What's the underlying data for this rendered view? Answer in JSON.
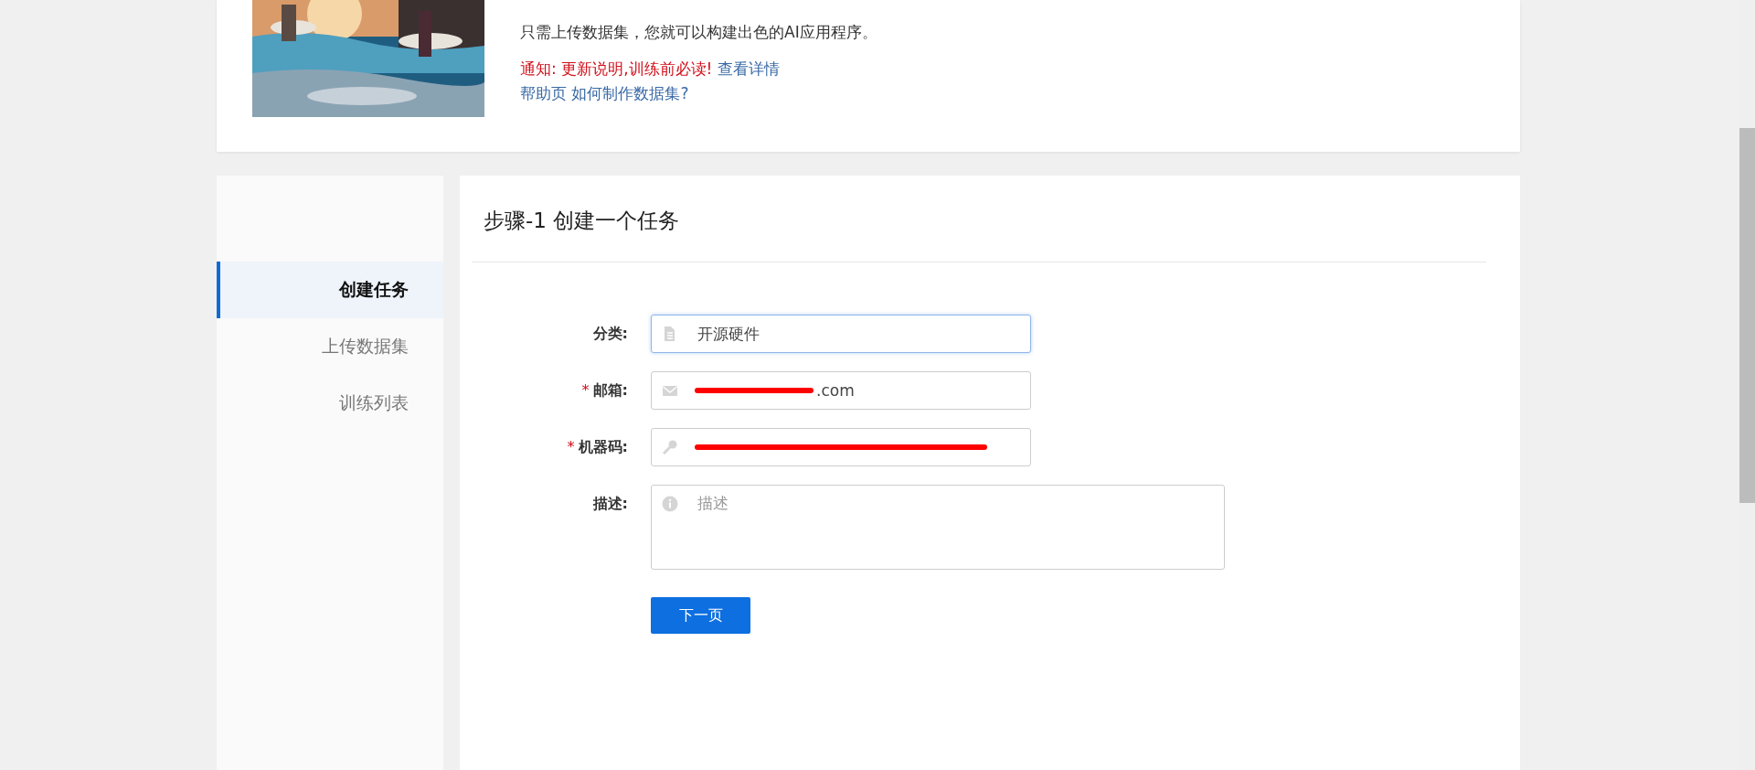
{
  "banner": {
    "intro": "只需上传数据集，您就可以构建出色的AI应用程序。",
    "notice": "通知: 更新说明,训练前必读!",
    "notice_link": "查看详情",
    "help_label": "帮助页",
    "help_link": "如何制作数据集?"
  },
  "sidebar": {
    "items": [
      {
        "label": "创建任务",
        "selected": true
      },
      {
        "label": "上传数据集",
        "selected": false
      },
      {
        "label": "训练列表",
        "selected": false
      }
    ]
  },
  "step_title": "步骤-1 创建一个任务",
  "form": {
    "fields": [
      {
        "label": "分类:",
        "value": "开源硬件",
        "focused": true,
        "redacted": false,
        "kind": "input"
      },
      {
        "required_mark": "*",
        "label": "邮箱:",
        "value": ".com",
        "focused": false,
        "redacted": true,
        "kind": "input"
      },
      {
        "required_mark": "*",
        "label": "机器码:",
        "focused": false,
        "redacted": true,
        "kind": "input"
      },
      {
        "label": "描述:",
        "placeholder": "描述",
        "kind": "textarea"
      }
    ],
    "next_button": "下一页"
  }
}
